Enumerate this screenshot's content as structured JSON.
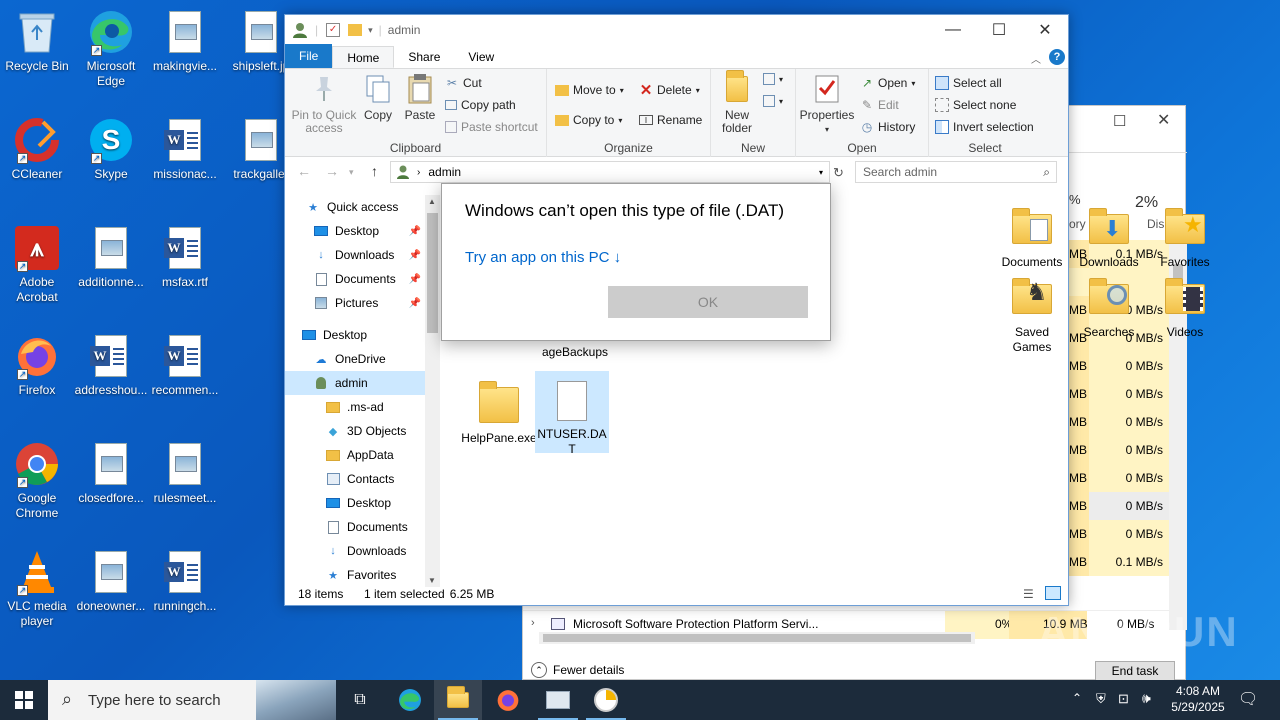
{
  "desktop": {
    "icons": [
      {
        "label": "Recycle Bin"
      },
      {
        "label": "Microsoft Edge"
      },
      {
        "label": "makingvie..."
      },
      {
        "label": "shipsleft.jp"
      },
      {
        "label": "CCleaner"
      },
      {
        "label": "Skype"
      },
      {
        "label": "missionac..."
      },
      {
        "label": "trackgaller"
      },
      {
        "label": "Adobe Acrobat"
      },
      {
        "label": "additionne..."
      },
      {
        "label": "msfax.rtf"
      },
      {
        "label": "Firefox"
      },
      {
        "label": "addresshou..."
      },
      {
        "label": "recommen..."
      },
      {
        "label": "Google Chrome"
      },
      {
        "label": "closedfore..."
      },
      {
        "label": "rulesmeet..."
      },
      {
        "label": "VLC media player"
      },
      {
        "label": "doneowner..."
      },
      {
        "label": "runningch..."
      }
    ]
  },
  "explorer": {
    "title": "admin",
    "tabs": {
      "file": "File",
      "home": "Home",
      "share": "Share",
      "view": "View"
    },
    "clipboard": {
      "pin": "Pin to Quick access",
      "copy": "Copy",
      "paste": "Paste",
      "cut": "Cut",
      "copy_path": "Copy path",
      "paste_shortcut": "Paste shortcut",
      "label": "Clipboard"
    },
    "organize": {
      "move_to": "Move to",
      "copy_to": "Copy to",
      "delete": "Delete",
      "rename": "Rename",
      "label": "Organize"
    },
    "new": {
      "new_folder": "New folder",
      "label": "New"
    },
    "open": {
      "properties": "Properties",
      "open": "Open",
      "edit": "Edit",
      "history": "History",
      "label": "Open"
    },
    "select": {
      "select_all": "Select all",
      "select_none": "Select none",
      "invert": "Invert selection",
      "label": "Select"
    },
    "address": {
      "path": "admin"
    },
    "search": {
      "placeholder": "Search admin"
    },
    "nav": [
      {
        "label": "Quick access",
        "icon": "star-icon"
      },
      {
        "label": "Desktop",
        "icon": "desktop-icon",
        "pinned": true
      },
      {
        "label": "Downloads",
        "icon": "download-icon",
        "pinned": true
      },
      {
        "label": "Documents",
        "icon": "document-icon",
        "pinned": true
      },
      {
        "label": "Pictures",
        "icon": "picture-icon",
        "pinned": true
      },
      {
        "label": "Desktop",
        "icon": "desktop-icon"
      },
      {
        "label": "OneDrive",
        "icon": "cloud-icon"
      },
      {
        "label": "admin",
        "icon": "user-icon"
      },
      {
        "label": ".ms-ad",
        "icon": "folder-icon"
      },
      {
        "label": "3D Objects",
        "icon": "cube-icon"
      },
      {
        "label": "AppData",
        "icon": "folder-icon"
      },
      {
        "label": "Contacts",
        "icon": "contacts-icon"
      },
      {
        "label": "Desktop",
        "icon": "desktop-icon"
      },
      {
        "label": "Documents",
        "icon": "document-icon"
      },
      {
        "label": "Downloads",
        "icon": "download-icon"
      },
      {
        "label": "Favorites",
        "icon": "star-icon"
      }
    ],
    "files": [
      {
        "label": "Documents"
      },
      {
        "label": "Downloads"
      },
      {
        "label": "Favorites"
      },
      {
        "label": "Saved Games"
      },
      {
        "label": "Searches"
      },
      {
        "label": "Videos"
      },
      {
        "label": "ageBackups"
      },
      {
        "label": "HelpPane.exe"
      },
      {
        "label": "NTUSER.DAT"
      }
    ],
    "status": {
      "count": "18 items",
      "selected": "1 item selected",
      "size": "6.25 MB"
    }
  },
  "dialog": {
    "title": "Windows can’t open this type of file (.DAT)",
    "link": "Try an app on this PC ↓",
    "ok": "OK"
  },
  "taskmgr": {
    "disk_pct": "2%",
    "disk_label": "Disk",
    "partial_pct": "%",
    "partial_label": "ory",
    "rows": [
      {
        "mem": "MB",
        "disk": "0.1 MB/s"
      },
      {
        "mem": "",
        "disk": ""
      },
      {
        "mem": "MB",
        "disk": "0 MB/s"
      },
      {
        "mem": "MB",
        "disk": "0 MB/s"
      },
      {
        "mem": "MB",
        "disk": "0 MB/s"
      },
      {
        "mem": "MB",
        "disk": "0 MB/s"
      },
      {
        "mem": "MB",
        "disk": "0 MB/s"
      },
      {
        "mem": "MB",
        "disk": "0 MB/s"
      },
      {
        "mem": "MB",
        "disk": "0 MB/s"
      },
      {
        "mem": "MB",
        "disk": "0 MB/s"
      },
      {
        "mem": "MB",
        "disk": "0 MB/s"
      },
      {
        "mem": "MB",
        "disk": "0.1 MB/s"
      }
    ],
    "process_name": "Microsoft Software Protection Platform Servi...",
    "process_cpu": "0%",
    "process_mem": "10.9 MB",
    "process_disk": "0 MB/s",
    "fewer": "Fewer details",
    "end_task": "End task"
  },
  "taskbar": {
    "search_placeholder": "Type here to search",
    "time": "4:08 AM",
    "date": "5/29/2025"
  },
  "watermark": "ANY.RUN"
}
